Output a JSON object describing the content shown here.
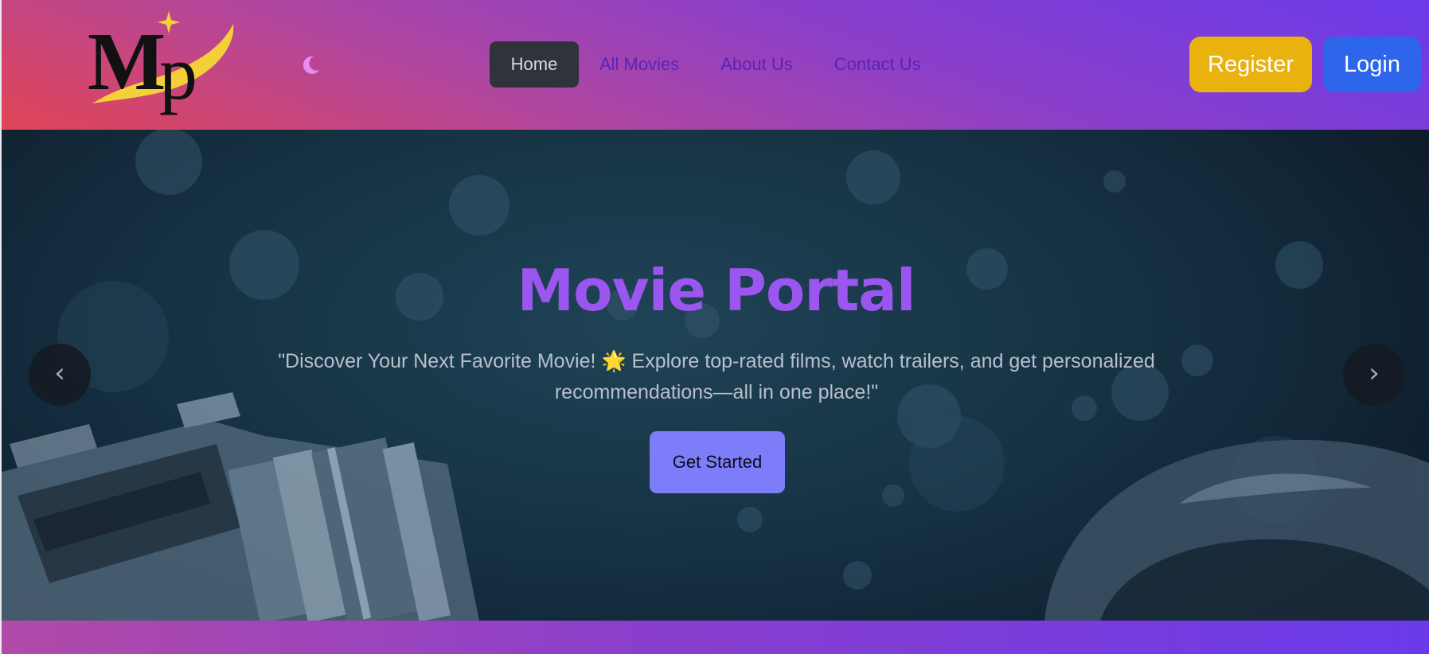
{
  "nav": {
    "logo_text": "Mp",
    "theme_icon": "moon-icon",
    "links": [
      {
        "label": "Home",
        "active": true
      },
      {
        "label": "All Movies",
        "active": false
      },
      {
        "label": "About Us",
        "active": false
      },
      {
        "label": "Contact Us",
        "active": false
      }
    ],
    "register_label": "Register",
    "login_label": "Login"
  },
  "hero": {
    "title": "Movie Portal",
    "subtitle_part1": "\"Discover Your Next Favorite Movie!",
    "subtitle_emoji": "🌟",
    "subtitle_part2": "Explore top-rated films, watch trailers, and get personalized recommendations—all in one place!\"",
    "cta_label": "Get Started",
    "prev_arrow": "‹",
    "next_arrow": "›"
  },
  "colors": {
    "title": "#9a56ee",
    "register": "#e9b20e",
    "login": "#2d66ea",
    "cta": "#7d7cf9",
    "nav_link": "#5a23b8",
    "nav_active_bg": "#2f333b"
  }
}
